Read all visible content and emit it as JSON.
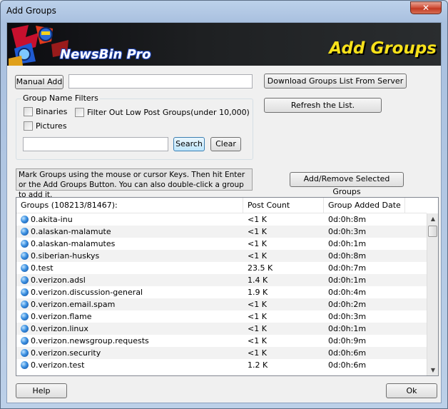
{
  "window": {
    "title": "Add Groups",
    "close_glyph": "✕"
  },
  "banner": {
    "brand": "NewsBin Pro",
    "title": "Add Groups"
  },
  "manual_add": {
    "label": "Manual Add",
    "value": ""
  },
  "download_button": "Download Groups List From Server",
  "refresh_button": "Refresh the List.",
  "filters": {
    "label": "Group Name Filters",
    "binaries": "Binaries",
    "pictures": "Pictures",
    "low_post": "Filter Out Low Post Groups(under 10,000)",
    "search_value": "",
    "search_button": "Search",
    "clear_button": "Clear"
  },
  "info_text": "Mark Groups using the mouse or cursor Keys. Then hit Enter or the Add Groups Button. You can also double-click a group to add it.",
  "add_remove_button": "Add/Remove Selected Groups",
  "list": {
    "headers": [
      "Groups (108213/81467):",
      "Post Count",
      "Group Added Date"
    ],
    "rows": [
      {
        "name": "0.akita-inu",
        "count": "<1 K",
        "date": "0d:0h:8m"
      },
      {
        "name": "0.alaskan-malamute",
        "count": "<1 K",
        "date": "0d:0h:3m"
      },
      {
        "name": "0.alaskan-malamutes",
        "count": "<1 K",
        "date": "0d:0h:1m"
      },
      {
        "name": "0.siberian-huskys",
        "count": "<1 K",
        "date": "0d:0h:8m"
      },
      {
        "name": "0.test",
        "count": "23.5 K",
        "date": "0d:0h:7m"
      },
      {
        "name": "0.verizon.adsl",
        "count": "1.4 K",
        "date": "0d:0h:1m"
      },
      {
        "name": "0.verizon.discussion-general",
        "count": "1.9 K",
        "date": "0d:0h:4m"
      },
      {
        "name": "0.verizon.email.spam",
        "count": "<1 K",
        "date": "0d:0h:2m"
      },
      {
        "name": "0.verizon.flame",
        "count": "<1 K",
        "date": "0d:0h:3m"
      },
      {
        "name": "0.verizon.linux",
        "count": "<1 K",
        "date": "0d:0h:1m"
      },
      {
        "name": "0.verizon.newsgroup.requests",
        "count": "<1 K",
        "date": "0d:0h:9m"
      },
      {
        "name": "0.verizon.security",
        "count": "<1 K",
        "date": "0d:0h:6m"
      },
      {
        "name": "0.verizon.test",
        "count": "1.2 K",
        "date": "0d:0h:6m"
      }
    ]
  },
  "help_button": "Help",
  "ok_button": "Ok"
}
